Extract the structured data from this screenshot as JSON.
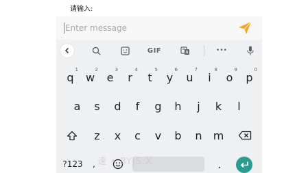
{
  "prompt": {
    "label": "请输入:"
  },
  "input": {
    "placeholder": "Enter message",
    "value": ""
  },
  "colors": {
    "accent": "#f5a623",
    "enter": "#2b9d8f",
    "keyboard_bg": "#eef0f2"
  },
  "toolbar": {
    "items": [
      {
        "icon": "chevron-left-icon"
      },
      {
        "icon": "search-icon"
      },
      {
        "icon": "sticker-icon"
      },
      {
        "label": "GIF"
      },
      {
        "icon": "translate-icon"
      },
      {
        "icon": "more-icon",
        "label": "•••"
      },
      {
        "icon": "mic-icon"
      }
    ]
  },
  "keyboard": {
    "row1": [
      {
        "key": "q",
        "hint": "1"
      },
      {
        "key": "w",
        "hint": "2"
      },
      {
        "key": "e",
        "hint": "3"
      },
      {
        "key": "r",
        "hint": "4"
      },
      {
        "key": "t",
        "hint": "5"
      },
      {
        "key": "y",
        "hint": "6"
      },
      {
        "key": "u",
        "hint": "7"
      },
      {
        "key": "i",
        "hint": "8"
      },
      {
        "key": "o",
        "hint": "9"
      },
      {
        "key": "p",
        "hint": "0"
      }
    ],
    "row2": [
      "a",
      "s",
      "d",
      "f",
      "g",
      "h",
      "j",
      "k",
      "l"
    ],
    "row3": [
      "z",
      "x",
      "c",
      "v",
      "b",
      "n",
      "m"
    ],
    "bottom": {
      "symbols_label": "?123",
      "comma": ",",
      "period": "."
    }
  },
  "watermark": "速 • BYJS.X"
}
